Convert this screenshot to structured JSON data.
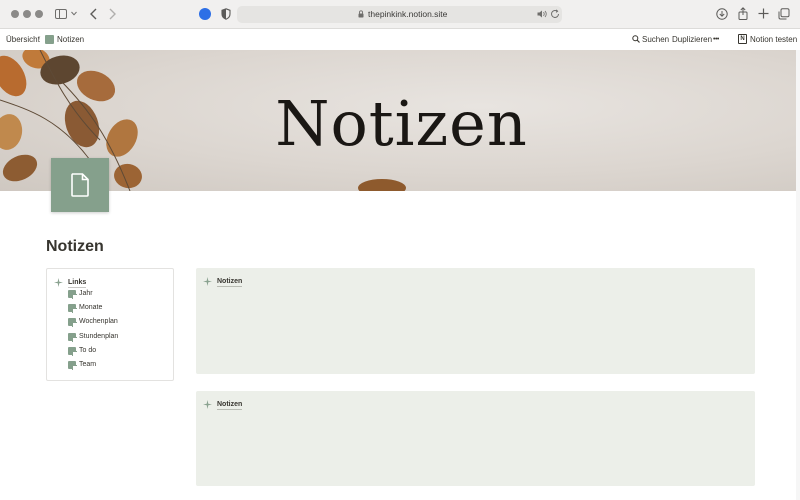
{
  "browser": {
    "url": "thepinkink.notion.site",
    "icons": [
      "sidebar-icon",
      "chevron-down-icon",
      "back-icon",
      "forward-icon",
      "extension-icon",
      "shield-icon",
      "lock-icon",
      "speaker-icon",
      "reload-icon",
      "download-icon",
      "share-icon",
      "new-tab-icon",
      "tabs-overview-icon"
    ]
  },
  "topbar": {
    "breadcrumb_root": "Übersicht",
    "breadcrumb_separator": "/",
    "breadcrumb_current": "Notizen",
    "search": "Suchen",
    "duplicate": "Duplizieren",
    "more": "•••",
    "notion_logo": "N",
    "try_notion": "Notion testen"
  },
  "cover": {
    "title": "Notizen"
  },
  "page": {
    "title": "Notizen",
    "links": {
      "heading": "Links",
      "items": [
        {
          "label": "Jahr"
        },
        {
          "label": "Monate"
        },
        {
          "label": "Wochenplan"
        },
        {
          "label": "Stundenplan"
        },
        {
          "label": "To do"
        },
        {
          "label": "Team"
        }
      ]
    },
    "panels": [
      {
        "heading": "Notizen"
      },
      {
        "heading": "Notizen"
      }
    ]
  },
  "colors": {
    "accent_sage": "#85a08c",
    "panel_bg": "#ecefe9",
    "text": "#37352f",
    "browser_blue": "#2d6fe6"
  }
}
